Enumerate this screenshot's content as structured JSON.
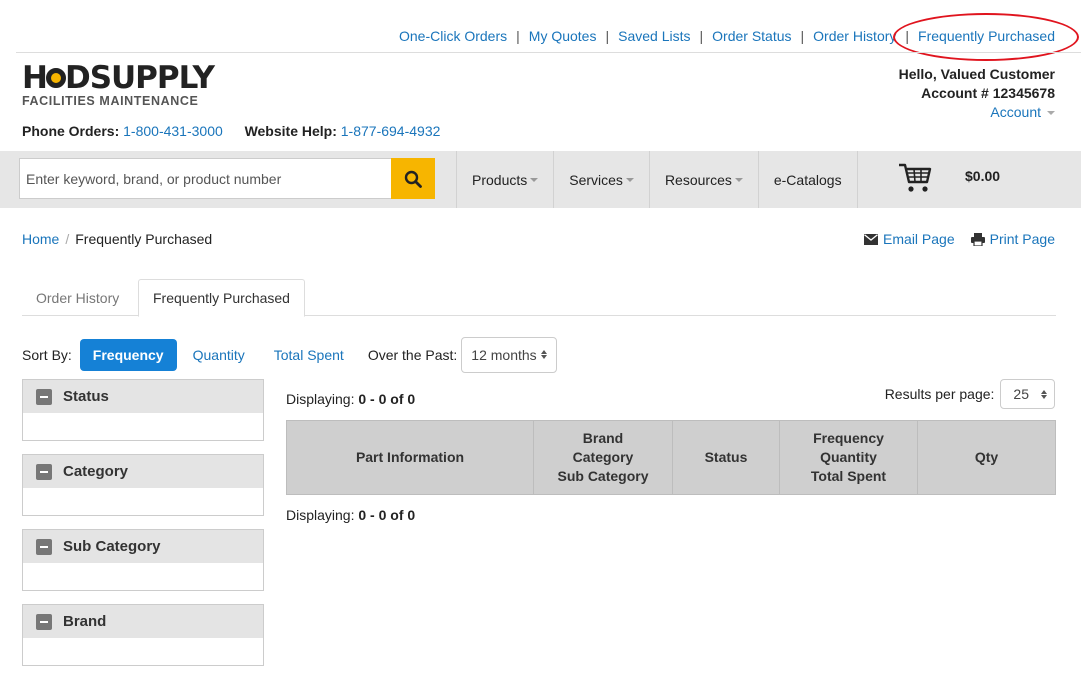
{
  "util_links": [
    "One-Click Orders",
    "My Quotes",
    "Saved Lists",
    "Order Status",
    "Order History",
    "Frequently Purchased"
  ],
  "logo": {
    "main": "HDSUPPLY",
    "sub": "FACILITIES MAINTENANCE"
  },
  "account": {
    "greeting": "Hello, Valued Customer",
    "number": "Account # 12345678",
    "link": "Account"
  },
  "phones": {
    "orders_label": "Phone Orders:",
    "orders_number": "1-800-431-3000",
    "help_label": "Website Help:",
    "help_number": "1-877-694-4932"
  },
  "search": {
    "placeholder": "Enter keyword, brand, or product number"
  },
  "nav": {
    "products": "Products",
    "services": "Services",
    "resources": "Resources",
    "ecatalogs": "e-Catalogs",
    "cart_total": "$0.00"
  },
  "breadcrumb": {
    "home": "Home",
    "current": "Frequently Purchased"
  },
  "page_actions": {
    "email": "Email Page",
    "print": "Print Page"
  },
  "tabs": {
    "order_history": "Order History",
    "frequently_purchased": "Frequently Purchased"
  },
  "sort": {
    "label": "Sort By:",
    "options": [
      "Frequency",
      "Quantity",
      "Total Spent"
    ],
    "over_label": "Over the Past:",
    "period": "12 months"
  },
  "filters": [
    "Status",
    "Category",
    "Sub Category",
    "Brand"
  ],
  "results": {
    "displaying_label": "Displaying:",
    "displaying_range": "0 - 0 of 0",
    "per_page_label": "Results per page:",
    "per_page": "25",
    "columns": {
      "part": "Part Information",
      "brand": [
        "Brand",
        "Category",
        "Sub Category"
      ],
      "status": "Status",
      "freq": [
        "Frequency",
        "Quantity",
        "Total Spent"
      ],
      "qty": "Qty"
    }
  },
  "colors": {
    "link": "#1a75bb",
    "accent_yellow": "#f7b500",
    "active_sort": "#1581d6",
    "highlight_circle": "#e0141e"
  }
}
